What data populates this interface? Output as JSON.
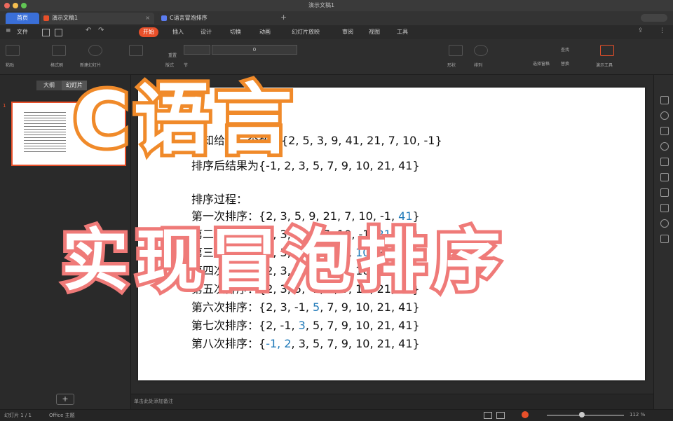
{
  "window": {
    "title": "演示文稿1"
  },
  "tabs": [
    {
      "label": "首页",
      "color": "#3a6fd8"
    },
    {
      "label": "演示文稿1",
      "color": "#e8502a"
    },
    {
      "label": "C语言冒泡排序",
      "color": "#5b7cf0"
    }
  ],
  "menus": [
    "文件",
    "开始",
    "插入",
    "设计",
    "切换",
    "动画",
    "幻灯片放映",
    "审阅",
    "视图",
    "工具"
  ],
  "ribbon": {
    "labels": [
      "粘贴",
      "格式刷",
      "新建幻灯片",
      "版式",
      "节",
      "重置",
      "形状",
      "排列",
      "查找",
      "替换",
      "选择窗格",
      "演示工具"
    ],
    "font_size": "0"
  },
  "left_panel": {
    "tab_outline": "大纲",
    "tab_slides": "幻灯片",
    "thumb_index": "1",
    "add_label": "+"
  },
  "slide": {
    "line1": "已知给定一个数组{2, 5, 3, 9, 41, 21, 7, 10, -1}",
    "line2": "排序后结果为{-1, 2, 3, 5, 7, 9, 10, 21, 41}",
    "process_title": "排序过程：",
    "steps": [
      {
        "label": "第一次排序：",
        "pre": "{2, 3, 5, 9, 21, 7, 10, -1, ",
        "hl": "41",
        "post": "}"
      },
      {
        "label": "第二次排序：",
        "pre": "{2, 3, 5, 9, 7, 10, -1, ",
        "hl": "21",
        "post": ", 41}"
      },
      {
        "label": "第三次排序：",
        "pre": "{2, 3, 5, 7, 9, -1, ",
        "hl": "10",
        "post": ", 21, 41}"
      },
      {
        "label": "第四次排序：",
        "pre": "{2, 3, 5, 7, -1, ",
        "hl": "9",
        "post": ", 10, 21, 41}"
      },
      {
        "label": "第五次排序：",
        "pre": "{2, 3, 5, -1, ",
        "hl": "7",
        "post": ", 9, 10, 21, 41}"
      },
      {
        "label": "第六次排序：",
        "pre": "{2, 3, -1, ",
        "hl": "5",
        "post": ", 7, 9, 10, 21, 41}"
      },
      {
        "label": "第七次排序：",
        "pre": "{2, -1, ",
        "hl": "3",
        "post": ", 5, 7, 9, 10, 21, 41}"
      },
      {
        "label": "第八次排序：",
        "pre": "{",
        "hl": "-1, 2",
        "post": ", 3, 5, 7, 9, 10, 21, 41}"
      }
    ]
  },
  "overlay": {
    "title_c": "C语言",
    "title_sort": "实现冒泡排序",
    "color_c": "#f08a2a",
    "color_sort": "#ef7a78"
  },
  "notes": {
    "placeholder": "单击此处添加备注"
  },
  "status": {
    "slide_info": "幻灯片 1 / 1",
    "theme": "Office 主题",
    "zoom": "112 %"
  }
}
